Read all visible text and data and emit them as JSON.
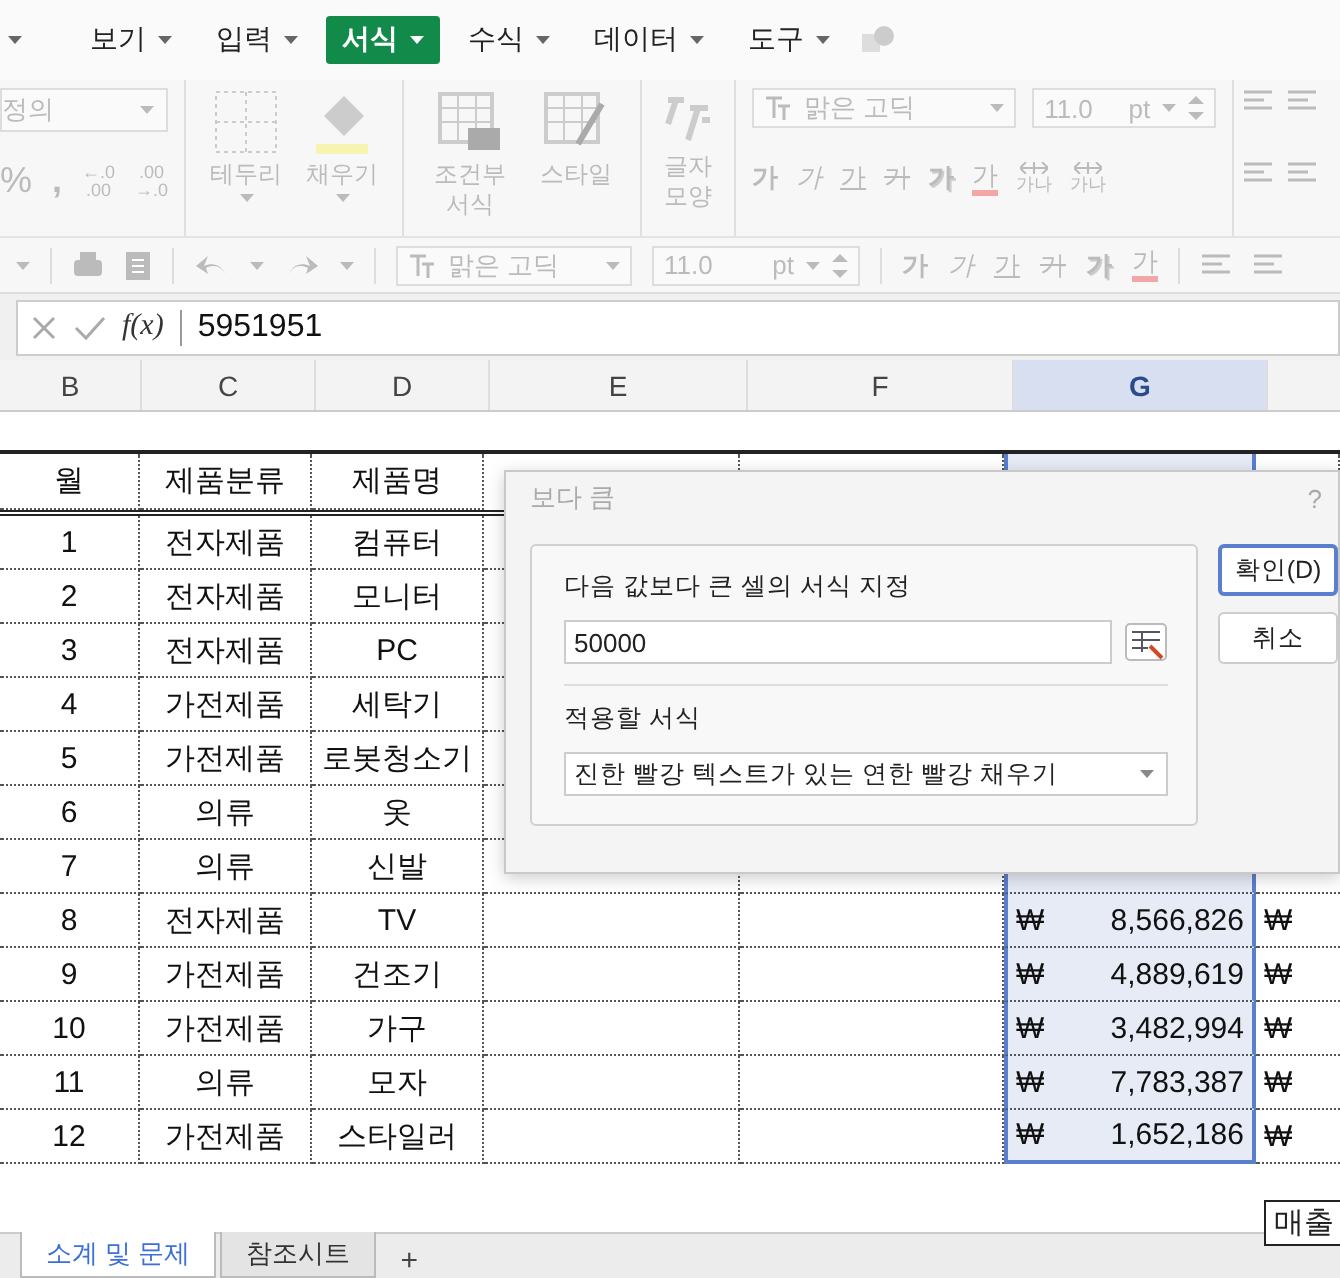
{
  "menu": [
    {
      "label": "보기",
      "selected": false
    },
    {
      "label": "입력",
      "selected": false
    },
    {
      "label": "서식",
      "selected": true
    },
    {
      "label": "수식",
      "selected": false
    },
    {
      "label": "데이터",
      "selected": false
    },
    {
      "label": "도구",
      "selected": false
    }
  ],
  "ribbon": {
    "name_box": "정의",
    "percent": "%",
    "comma": ",",
    "decimals": [
      {
        "top": "←.0",
        "bottom": ".00"
      },
      {
        "top": ".00",
        "bottom": "→.0"
      }
    ],
    "border": "테두리",
    "fill": "채우기",
    "conditional": "조건부 서식",
    "style": "스타일",
    "char_shape": "글자 모양",
    "font": "맑은 고딕",
    "size": "11.0",
    "unit": "pt",
    "format_buttons": [
      {
        "kind": "bold",
        "label": "가"
      },
      {
        "kind": "italic",
        "label": "가"
      },
      {
        "kind": "underline",
        "label": "가"
      },
      {
        "kind": "strike",
        "label": "가"
      },
      {
        "kind": "shadow",
        "label": "가"
      },
      {
        "kind": "color",
        "label": "가"
      }
    ],
    "spacing": [
      "가나",
      "가나"
    ]
  },
  "toolbar": {
    "font": "맑은 고딕",
    "size": "11.0",
    "unit": "pt",
    "format_buttons": [
      {
        "kind": "bold",
        "label": "가"
      },
      {
        "kind": "italic",
        "label": "가"
      },
      {
        "kind": "underline",
        "label": "가"
      },
      {
        "kind": "strike",
        "label": "가"
      },
      {
        "kind": "shadow",
        "label": "가"
      },
      {
        "kind": "color",
        "label": "가"
      }
    ]
  },
  "formula": {
    "fx": "f(x)",
    "value": "5951951"
  },
  "columns": [
    {
      "label": "B",
      "selected": false
    },
    {
      "label": "C",
      "selected": false
    },
    {
      "label": "D",
      "selected": false
    },
    {
      "label": "E",
      "selected": false
    },
    {
      "label": "F",
      "selected": false
    },
    {
      "label": "G",
      "selected": true
    }
  ],
  "header_row": [
    "월",
    "제품분류",
    "제품명"
  ],
  "rows": [
    {
      "month": "1",
      "category": "전자제품",
      "product": "컴퓨터"
    },
    {
      "month": "2",
      "category": "전자제품",
      "product": "모니터"
    },
    {
      "month": "3",
      "category": "전자제품",
      "product": "PC"
    },
    {
      "month": "4",
      "category": "가전제품",
      "product": "세탁기"
    },
    {
      "month": "5",
      "category": "가전제품",
      "product": "로봇청소기"
    },
    {
      "month": "6",
      "category": "의류",
      "product": "옷"
    },
    {
      "month": "7",
      "category": "의류",
      "product": "신발"
    },
    {
      "month": "8",
      "category": "전자제품",
      "product": "TV",
      "currency": "₩",
      "sales": "8,566,826",
      "next": "₩"
    },
    {
      "month": "9",
      "category": "가전제품",
      "product": "건조기",
      "currency": "₩",
      "sales": "4,889,619",
      "next": "₩"
    },
    {
      "month": "10",
      "category": "가전제품",
      "product": "가구",
      "currency": "₩",
      "sales": "3,482,994",
      "next": "₩"
    },
    {
      "month": "11",
      "category": "의류",
      "product": "모자",
      "currency": "₩",
      "sales": "7,783,387",
      "next": "₩"
    },
    {
      "month": "12",
      "category": "가전제품",
      "product": "스타일러",
      "currency": "₩",
      "sales": "1,652,186",
      "next": "₩"
    }
  ],
  "dialog": {
    "title": "보다 큼",
    "help": "?",
    "label": "다음 값보다 큰 셀의 서식 지정",
    "value": "50000",
    "format_label": "적용할 서식",
    "format_value": "진한 빨강 텍스트가 있는 연한 빨강 채우기",
    "buttons": [
      {
        "label": "확인(D)",
        "default": true
      },
      {
        "label": "취소",
        "default": false
      }
    ]
  },
  "note": "매출",
  "sheet_tabs": [
    {
      "label": "소계 및 문제",
      "selected": true
    },
    {
      "label": "참조시트",
      "selected": false
    }
  ],
  "add_tab": "+"
}
